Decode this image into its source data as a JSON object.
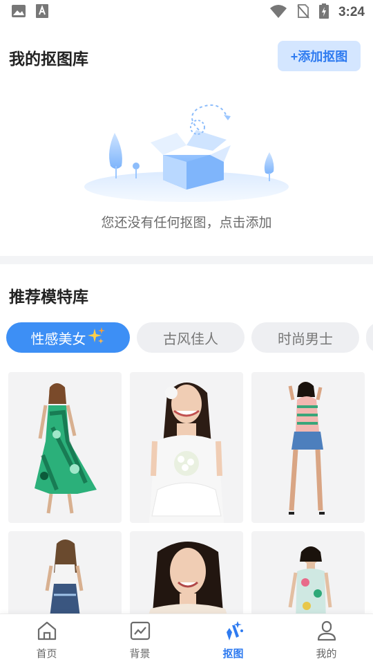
{
  "status_bar": {
    "time": "3:24",
    "icons": [
      "gallery-icon",
      "a-notify-icon",
      "wifi-icon",
      "no-sim-icon",
      "battery-charging-icon"
    ]
  },
  "library": {
    "title": "我的抠图库",
    "add_button_label": "+添加抠图",
    "empty_text": "您还没有任何抠图，点击添加"
  },
  "models": {
    "title": "推荐模特库",
    "tabs": [
      {
        "label": "性感美女",
        "active": true,
        "badge_icon": "sparkle-icon"
      },
      {
        "label": "古风佳人",
        "active": false
      },
      {
        "label": "时尚男士",
        "active": false
      },
      {
        "label": "",
        "active": false
      }
    ],
    "items": [
      {
        "name": "model-green-floral-dress"
      },
      {
        "name": "model-white-wedding-dress"
      },
      {
        "name": "model-floral-top-denim-shorts"
      },
      {
        "name": "model-white-top-skirt"
      },
      {
        "name": "model-portrait-smile"
      },
      {
        "name": "model-halter-floral-top"
      }
    ]
  },
  "bottom_nav": [
    {
      "label": "首页",
      "icon": "home-icon",
      "active": false
    },
    {
      "label": "背景",
      "icon": "background-icon",
      "active": false
    },
    {
      "label": "抠图",
      "icon": "magic-wand-icon",
      "active": true
    },
    {
      "label": "我的",
      "icon": "profile-icon",
      "active": false
    }
  ],
  "colors": {
    "accent": "#3d8ff5",
    "accent_text": "#2f7bf0",
    "add_button_bg": "#d4e6ff",
    "divider": "#f3f4f6",
    "card_bg": "#f3f3f4"
  }
}
